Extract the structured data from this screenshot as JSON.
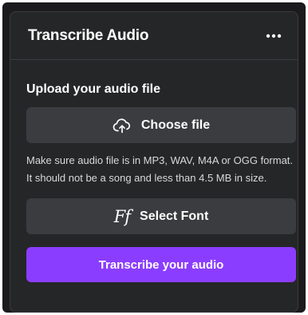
{
  "panel": {
    "title": "Transcribe Audio",
    "more_icon": "more-horizontal-icon"
  },
  "upload": {
    "label": "Upload your audio file",
    "choose_file_label": "Choose file",
    "choose_file_icon": "cloud-upload-icon",
    "help_text": "Make sure audio file is in MP3, WAV, M4A or OGG format. It should not be a song and less than 4.5 MB in size."
  },
  "font": {
    "glyph": "Ff",
    "select_font_label": "Select Font"
  },
  "actions": {
    "transcribe_label": "Transcribe your audio"
  },
  "colors": {
    "panel_bg": "#252627",
    "button_bg": "#3b3c3f",
    "accent": "#8b3dff"
  }
}
